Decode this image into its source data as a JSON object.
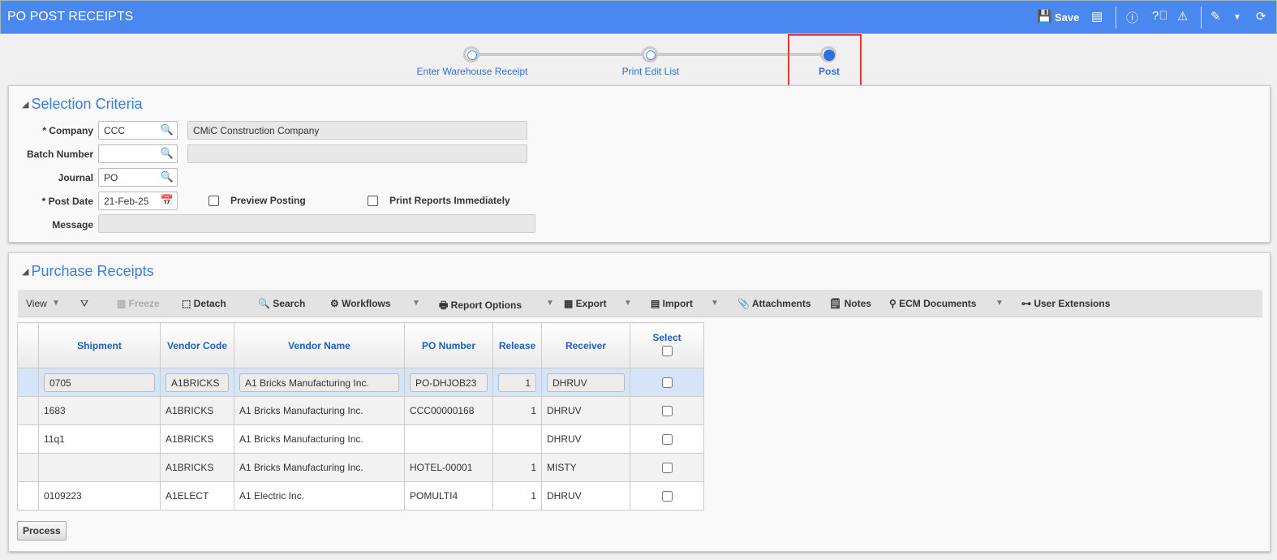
{
  "header": {
    "title": "PO POST RECEIPTS",
    "save_label": "Save"
  },
  "stepper": {
    "steps": [
      "Enter Warehouse Receipt",
      "Print Edit List",
      "Post"
    ],
    "active": 2
  },
  "selection": {
    "title": "Selection Criteria",
    "company_label": "* Company",
    "company_value": "CCC",
    "company_name": "CMiC Construction Company",
    "batch_label": "Batch Number",
    "batch_value": "",
    "journal_label": "Journal",
    "journal_value": "PO",
    "post_date_label": "* Post Date",
    "post_date_value": "21-Feb-25",
    "preview_label": "Preview Posting",
    "print_label": "Print Reports Immediately",
    "message_label": "Message"
  },
  "receipts": {
    "title": "Purchase Receipts",
    "toolbar": [
      "View",
      "Freeze",
      "Detach",
      "Search",
      "Workflows",
      "Report Options",
      "Export",
      "Import",
      "Attachments",
      "Notes",
      "ECM Documents",
      "User Extensions"
    ],
    "columns": [
      "Shipment",
      "Vendor Code",
      "Vendor Name",
      "PO Number",
      "Release",
      "Receiver",
      "Select"
    ],
    "rows": [
      [
        "0705",
        "A1BRICKS",
        "A1 Bricks Manufacturing Inc.",
        "PO-DHJOB23",
        "1",
        "DHRUV"
      ],
      [
        "1683",
        "A1BRICKS",
        "A1 Bricks Manufacturing Inc.",
        "CCC00000168",
        "1",
        "DHRUV"
      ],
      [
        "11q1",
        "A1BRICKS",
        "A1 Bricks Manufacturing Inc.",
        "",
        "",
        "DHRUV"
      ],
      [
        "",
        "A1BRICKS",
        "A1 Bricks Manufacturing Inc.",
        "HOTEL-00001",
        "1",
        "MISTY"
      ],
      [
        "0109223",
        "A1ELECT",
        "A1 Electric Inc.",
        "POMULTI4",
        "1",
        "DHRUV"
      ]
    ],
    "process_label": "Process"
  }
}
